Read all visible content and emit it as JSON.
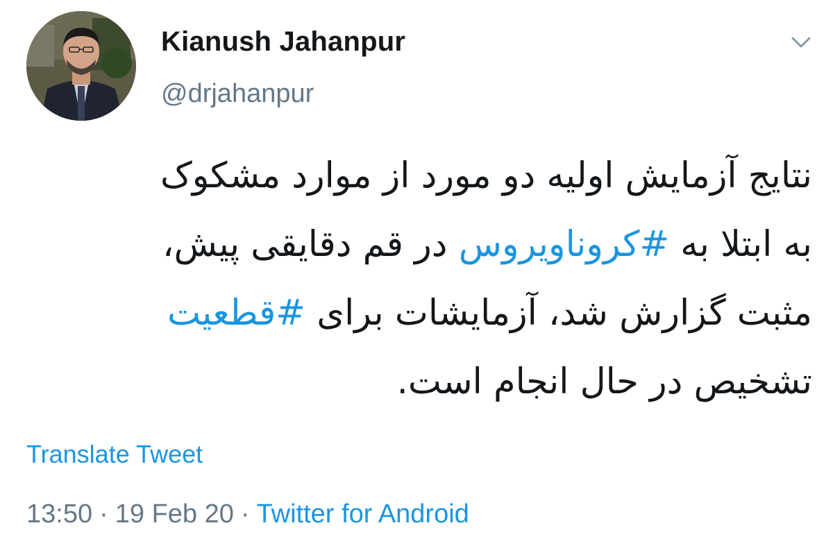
{
  "user": {
    "display_name": "Kianush Jahanpur",
    "handle": "@drjahanpur",
    "avatar_icon": "user-avatar"
  },
  "menu": {
    "caret_icon": "chevron-down-icon"
  },
  "tweet": {
    "line1": "نتایج آزمایش اولیه دو مورد از موارد مشکوک",
    "line2_before": "به ابتلا به ",
    "hashtag1": "#کروناویروس",
    "line2_after": " در قم دقایقی پیش،",
    "line3_before": "مثبت گزارش شد، آزمایشات برای ",
    "hashtag2": "#قطعیت",
    "line4": "تشخیص در حال انجام است."
  },
  "translate_label": "Translate Tweet",
  "meta": {
    "time": "13:50",
    "separator": "·",
    "date": "19 Feb 20",
    "source": "Twitter for Android"
  },
  "colors": {
    "link": "#1b95e0",
    "secondary": "#657786",
    "text": "#14171a"
  }
}
